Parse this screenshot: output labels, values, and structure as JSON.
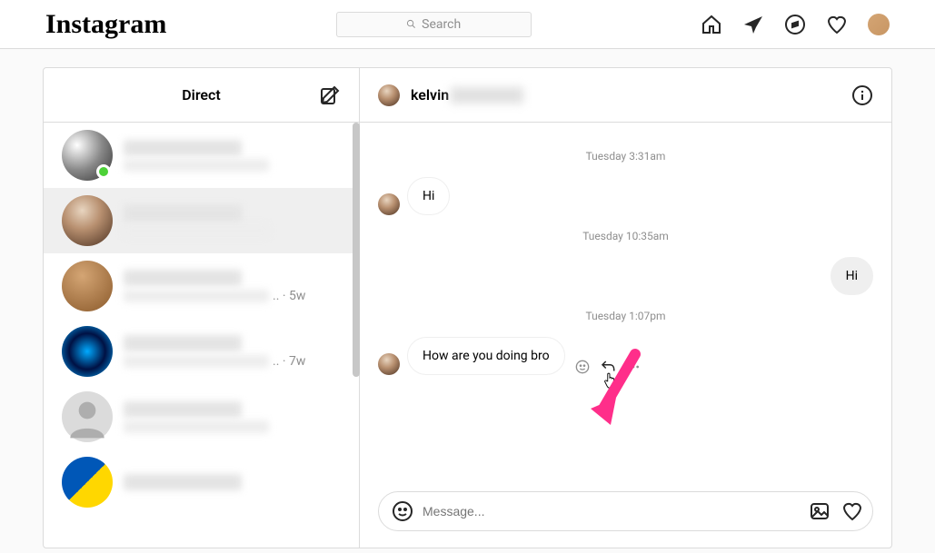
{
  "nav": {
    "logo": "Instagram",
    "search_placeholder": "Search"
  },
  "rail": {
    "title": "Direct",
    "items": [
      {
        "online": true,
        "time": ""
      },
      {
        "online": false,
        "time": ""
      },
      {
        "online": false,
        "time": "5w"
      },
      {
        "online": false,
        "time": "7w"
      },
      {
        "online": false,
        "time": ""
      },
      {
        "online": false,
        "time": ""
      }
    ]
  },
  "chat": {
    "header_name": "kelvin",
    "ts1": "Tuesday 3:31am",
    "msg1": "Hi",
    "ts2": "Tuesday 10:35am",
    "msg2": "Hi",
    "ts3": "Tuesday 1:07pm",
    "msg3": "How are you doing bro",
    "composer_placeholder": "Message..."
  },
  "colors": {
    "annotation_arrow": "#ff2e8a"
  }
}
